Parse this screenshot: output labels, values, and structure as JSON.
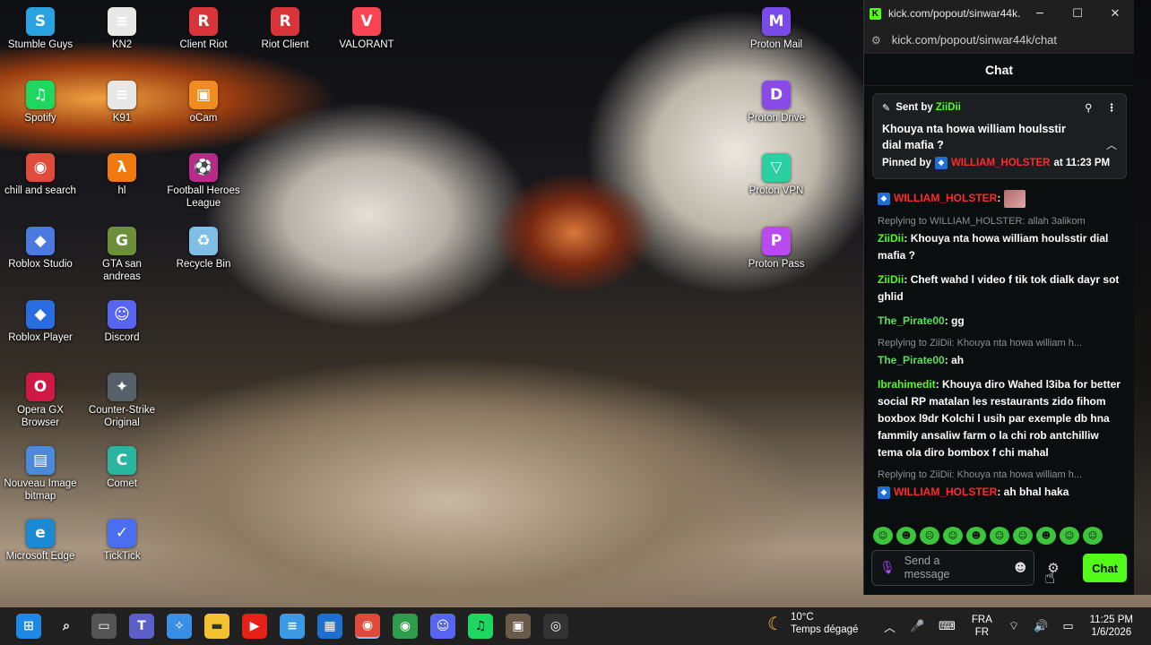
{
  "desktop": {
    "icons": [
      {
        "label": "Stumble Guys",
        "glyph": "S",
        "color": "#29a3e0"
      },
      {
        "label": "KN2",
        "glyph": "≡",
        "color": "#e8e8e8"
      },
      {
        "label": "Client Riot",
        "glyph": "R",
        "color": "#d9343a"
      },
      {
        "label": "Riot Client",
        "glyph": "R",
        "color": "#d9343a"
      },
      {
        "label": "VALORANT",
        "glyph": "V",
        "color": "#fa4454"
      },
      {
        "label": "Spotify",
        "glyph": "♫",
        "color": "#1ed760"
      },
      {
        "label": "K91",
        "glyph": "≡",
        "color": "#e8e8e8"
      },
      {
        "label": "oCam",
        "glyph": "▣",
        "color": "#f08c20"
      },
      {
        "label": "chill and search",
        "glyph": "◉",
        "color": "#e24a3a"
      },
      {
        "label": "hl",
        "glyph": "λ",
        "color": "#f07a10"
      },
      {
        "label": "Football Heroes League",
        "glyph": "⚽",
        "color": "#b82a8a"
      },
      {
        "label": "Roblox Studio",
        "glyph": "◆",
        "color": "#4a7ae0"
      },
      {
        "label": "GTA san andreas",
        "glyph": "G",
        "color": "#6b8f3a"
      },
      {
        "label": "Recycle Bin",
        "glyph": "♻",
        "color": "#7fbfe6"
      },
      {
        "label": "Roblox Player",
        "glyph": "◆",
        "color": "#2a6de0"
      },
      {
        "label": "Discord",
        "glyph": "☺",
        "color": "#5865f2"
      },
      {
        "label": "Opera GX Browser",
        "glyph": "O",
        "color": "#d01844"
      },
      {
        "label": "Counter-Strike Original",
        "glyph": "✦",
        "color": "#55606a"
      },
      {
        "label": "Nouveau Image bitmap",
        "glyph": "▤",
        "color": "#4a8ad8"
      },
      {
        "label": "Comet",
        "glyph": "C",
        "color": "#2ab5a0"
      },
      {
        "label": "Microsoft Edge",
        "glyph": "e",
        "color": "#1a8ad4"
      },
      {
        "label": "TickTick",
        "glyph": "✓",
        "color": "#4a6ef0"
      },
      {
        "label": "Proton Mail",
        "glyph": "M",
        "color": "#7a4ae8"
      },
      {
        "label": "Proton Drive",
        "glyph": "D",
        "color": "#8a4ae8"
      },
      {
        "label": "Proton VPN",
        "glyph": "▽",
        "color": "#2ad0a0"
      },
      {
        "label": "Proton Pass",
        "glyph": "P",
        "color": "#b84af0"
      }
    ]
  },
  "browser": {
    "title": "kick.com/popout/sinwar44k...",
    "url": "kick.com/popout/sinwar44k/chat",
    "chat_header": "Chat",
    "pinned": {
      "sent_by_label": "Sent by",
      "sent_by_user": "ZiiDii",
      "message": "Khouya nta howa william houlsstir dial mafia ?",
      "pinned_by_label": "Pinned by",
      "pinned_by_user": "WILLIAM_HOLSTER",
      "pinned_at": "at 11:23 PM"
    },
    "messages": [
      {
        "user": "WILLIAM_HOLSTER",
        "text": ""
      },
      {
        "reply": "Replying to WILLIAM_HOLSTER: allah 3alikom",
        "user": "ZiiDii",
        "text": "Khouya nta howa william houlsstir dial mafia ?"
      },
      {
        "user": "ZiiDii",
        "text": "Cheft wahd l video f tik tok dialk dayr sot ghlid"
      },
      {
        "user": "The_Pirate00",
        "text": "gg"
      },
      {
        "reply": "Replying to ZiiDii: Khouya nta howa william h...",
        "user": "The_Pirate00",
        "text": "ah"
      },
      {
        "user": "Ibrahimedit",
        "text": "Khouya diro Wahed l3iba for better social RP matalan les restaurants zido fihom boxbox l9dr Kolchi l usih par exemple db hna fammily ansaliw farm o la chi rob antchilliw tema ola diro bombox f chi mahal"
      },
      {
        "reply": "Replying to ZiiDii: Khouya nta howa william h...",
        "user": "WILLIAM_HOLSTER",
        "text": "ah bhal haka"
      }
    ],
    "composer": {
      "placeholder_line1": "Send a",
      "placeholder_line2": "message",
      "send_label": "Chat"
    }
  },
  "taskbar": {
    "weather_temp": "10°C",
    "weather_desc": "Temps dégagé",
    "lang1": "FRA",
    "lang2": "FR",
    "time": "11:25 PM",
    "date": "1/6/2026"
  }
}
